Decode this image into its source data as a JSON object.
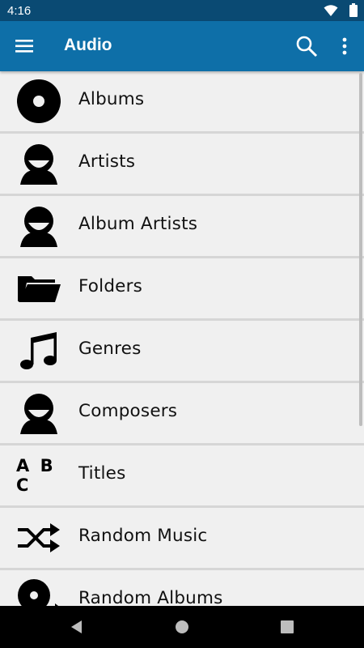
{
  "status_bar": {
    "time": "4:16",
    "icons": [
      "wifi-icon",
      "battery-icon"
    ]
  },
  "app_bar": {
    "title": "Audio",
    "icons": [
      "menu-icon",
      "search-icon",
      "more-vert-icon"
    ],
    "background_color": "#0e6fa8",
    "status_color": "#0a4a73"
  },
  "list": {
    "items": [
      {
        "label": "Albums",
        "icon": "album-icon"
      },
      {
        "label": "Artists",
        "icon": "artist-icon"
      },
      {
        "label": "Album Artists",
        "icon": "album-artist-icon"
      },
      {
        "label": "Folders",
        "icon": "folder-icon"
      },
      {
        "label": "Genres",
        "icon": "music-note-icon"
      },
      {
        "label": "Composers",
        "icon": "composer-icon"
      },
      {
        "label": "Titles",
        "icon": "abc-icon",
        "icon_text": "A B C"
      },
      {
        "label": "Random Music",
        "icon": "shuffle-icon"
      },
      {
        "label": "Random Albums",
        "icon": "random-album-icon"
      }
    ]
  },
  "nav_bar": {
    "buttons": [
      "back-icon",
      "home-icon",
      "recents-icon"
    ]
  }
}
